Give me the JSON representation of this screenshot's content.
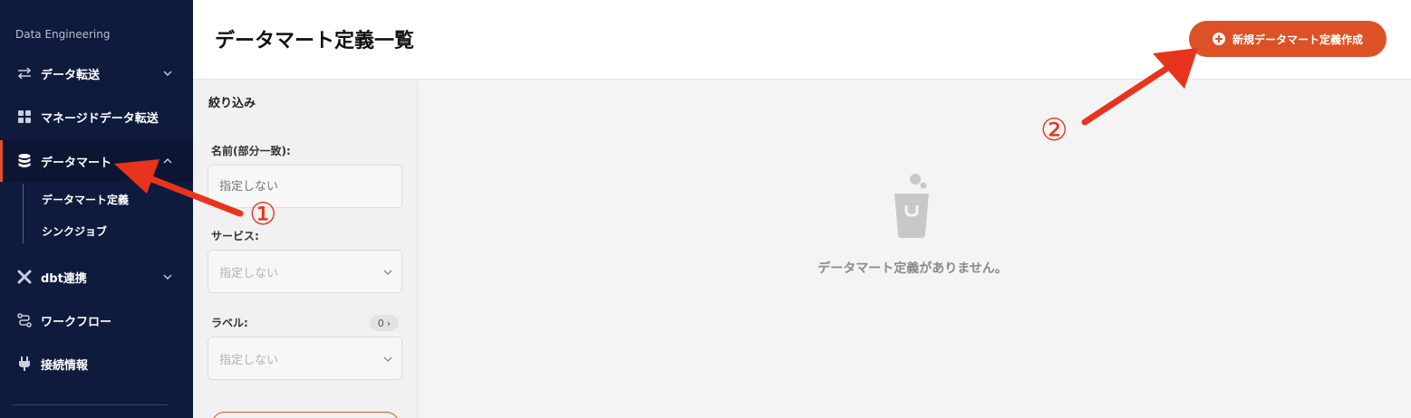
{
  "sidebar": {
    "section_label": "Data Engineering",
    "items": [
      {
        "label": "データ転送",
        "icon": "transfer-icon"
      },
      {
        "label": "マネージドデータ転送",
        "icon": "grid-icon"
      },
      {
        "label": "データマート",
        "icon": "database-icon",
        "active": true
      },
      {
        "label": "dbt連携",
        "icon": "dbt-icon"
      },
      {
        "label": "ワークフロー",
        "icon": "workflow-icon"
      },
      {
        "label": "接続情報",
        "icon": "plug-icon"
      }
    ],
    "sub_items": [
      "データマート定義",
      "シンクジョブ"
    ]
  },
  "header": {
    "title": "データマート定義一覧",
    "create_button": "新規データマート定義作成"
  },
  "filter": {
    "title": "絞り込み",
    "name_label": "名前(部分一致):",
    "name_placeholder": "指定しない",
    "service_label": "サービス:",
    "service_value": "指定しない",
    "label_label": "ラベル:",
    "label_count": "0",
    "label_value": "指定しない"
  },
  "main": {
    "empty_message": "データマート定義がありません。"
  },
  "annotations": {
    "one": "①",
    "two": "②"
  },
  "colors": {
    "sidebar_bg": "#0f1b3d",
    "accent": "#dc5226",
    "annotation_red": "#e8341c"
  }
}
